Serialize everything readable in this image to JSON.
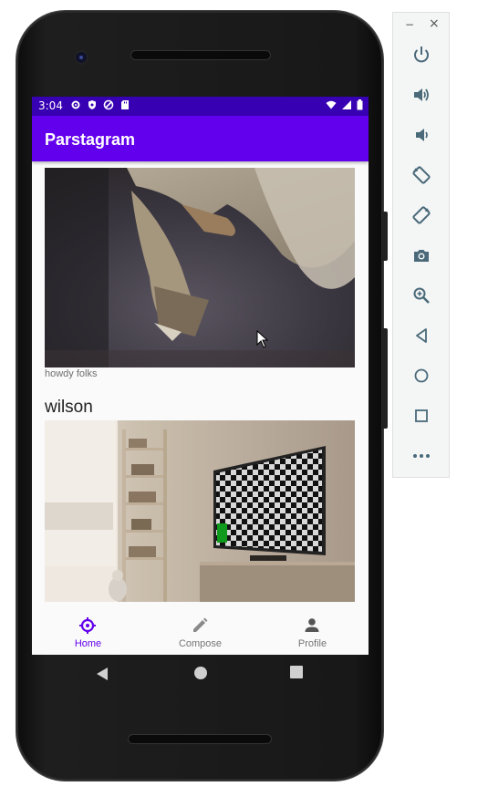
{
  "status_bar": {
    "time": "3:04",
    "left_icons": [
      "settings-icon",
      "shield-icon",
      "sync-icon",
      "sd-card-icon"
    ],
    "right_icons": [
      "wifi-icon",
      "signal-icon",
      "battery-icon"
    ]
  },
  "app_bar": {
    "title": "Parstagram"
  },
  "feed": {
    "posts": [
      {
        "username": "",
        "caption": "howdy folks",
        "image": "close-up-photo"
      },
      {
        "username": "wilson",
        "caption": "",
        "image": "room-with-tv-photo"
      }
    ]
  },
  "bottom_nav": {
    "items": [
      {
        "label": "Home",
        "icon": "home-icon",
        "selected": true
      },
      {
        "label": "Compose",
        "icon": "pencil-icon",
        "selected": false
      },
      {
        "label": "Profile",
        "icon": "person-icon",
        "selected": false
      }
    ]
  },
  "system_nav": {
    "buttons": [
      "back-icon",
      "home-circle-icon",
      "recents-icon"
    ]
  },
  "emulator_toolbar": {
    "window_controls": {
      "minimize": "−",
      "close": "×"
    },
    "buttons": [
      "power-icon",
      "volume-up-icon",
      "volume-down-icon",
      "rotate-left-icon",
      "rotate-right-icon",
      "camera-icon",
      "zoom-icon",
      "back-icon",
      "home-icon",
      "overview-icon",
      "more-icon"
    ]
  },
  "colors": {
    "primary": "#6200ee",
    "primary_dark": "#3700b3",
    "nav_selected": "#6200ee",
    "nav_unselected": "#757575",
    "toolbar_icon": "#4a6a7a"
  }
}
